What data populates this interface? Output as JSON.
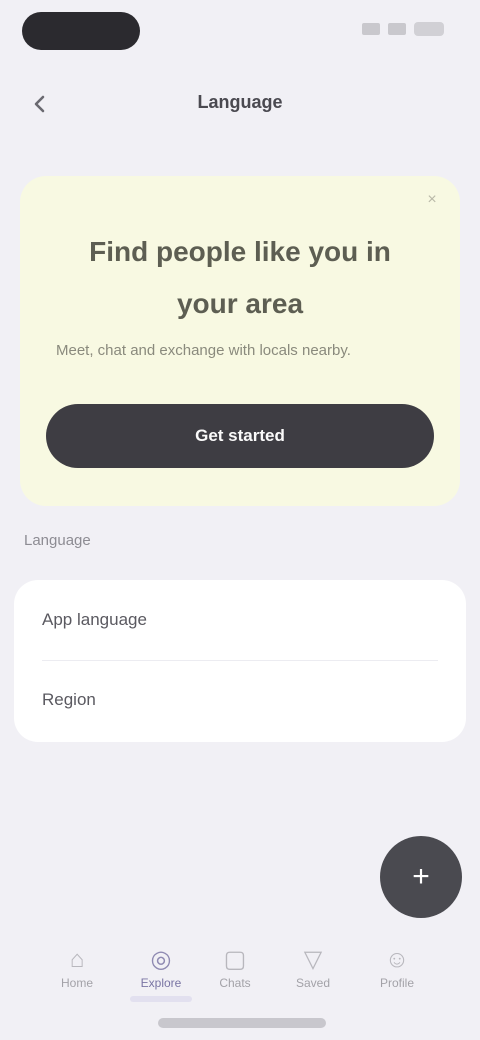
{
  "nav": {
    "title": "Language"
  },
  "promo": {
    "headline": "Find people like you in your area",
    "body": "Meet, chat and exchange with locals nearby.",
    "cta": "Get started",
    "close": "×"
  },
  "section": {
    "label": "Language"
  },
  "list": {
    "items": [
      {
        "label": "App language"
      },
      {
        "label": "Region"
      }
    ]
  },
  "fab": {
    "symbol": "+"
  },
  "tabs": [
    {
      "label": "Home",
      "icon": "home-icon"
    },
    {
      "label": "Explore",
      "icon": "compass-icon"
    },
    {
      "label": "Chats",
      "icon": "chat-icon"
    },
    {
      "label": "Saved",
      "icon": "bookmark-icon"
    },
    {
      "label": "Profile",
      "icon": "person-icon"
    }
  ],
  "colors": {
    "background": "#f1f0f5",
    "promo_card": "#f8f9e2",
    "primary_button": "#3e3d43",
    "active_tab": "#8f8ab2"
  }
}
